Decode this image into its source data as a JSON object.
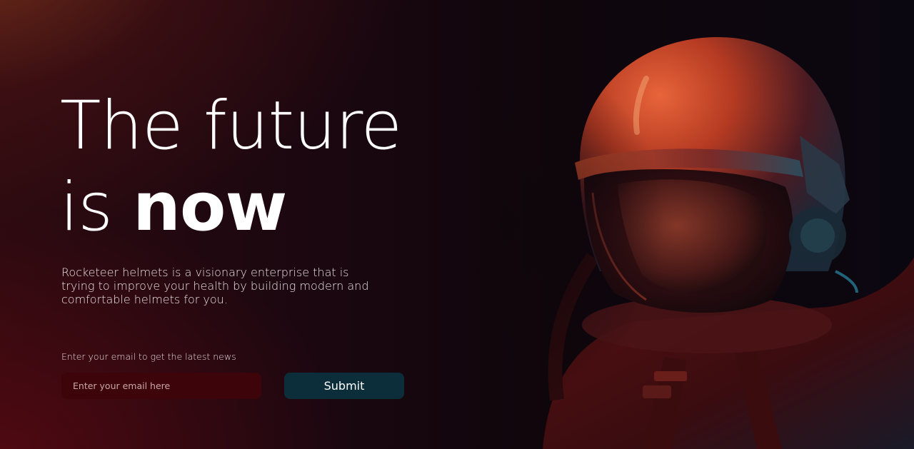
{
  "hero": {
    "headline_line1": "The future",
    "headline_line2_prefix": "is",
    "headline_line2_emphasis": "now",
    "tagline": "Rocketeer helmets is a visionary enterprise that is trying to improve your health by building modern and comfortable helmets for you."
  },
  "signup": {
    "label": "Enter your email to get the latest news",
    "email_placeholder": "Enter your email here",
    "email_value": "",
    "submit_label": "Submit"
  },
  "colors": {
    "input_background": "#3d0509",
    "button_background": "#0c2e3a",
    "text": "#ffffff"
  }
}
